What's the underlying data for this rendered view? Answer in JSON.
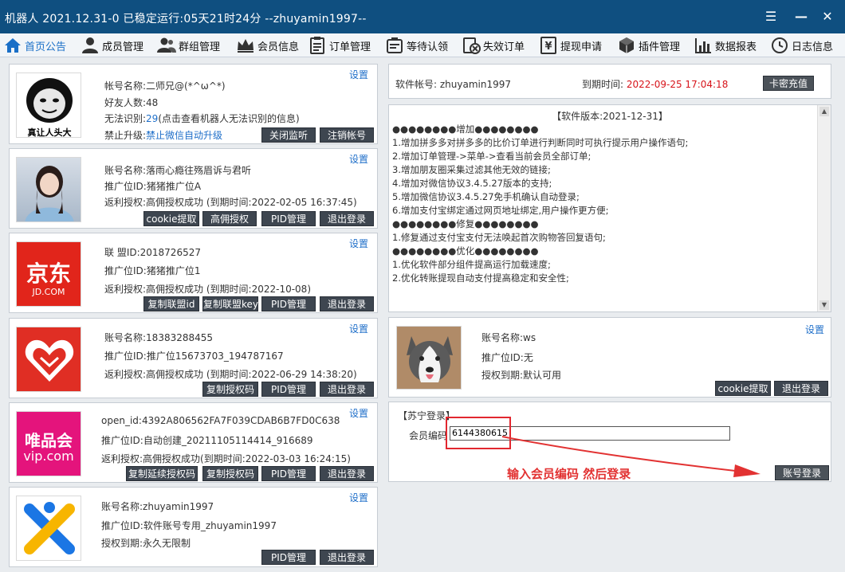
{
  "window": {
    "title": "机器人 2021.12.31-0 已稳定运行:05天21时24分 --zhuyamin1997--",
    "menu_glyph": "☰",
    "minimize_glyph": "—",
    "close_glyph": "✕"
  },
  "nav": {
    "tabs": [
      {
        "label": "首页公告",
        "icon": "home-icon"
      },
      {
        "label": "成员管理",
        "icon": "user-icon"
      },
      {
        "label": "群组管理",
        "icon": "group-icon"
      },
      {
        "label": "会员信息",
        "icon": "crown-icon"
      },
      {
        "label": "订单管理",
        "icon": "list-icon"
      },
      {
        "label": "等待认领",
        "icon": "clipboard-icon"
      },
      {
        "label": "失效订单",
        "icon": "expired-icon"
      },
      {
        "label": "提现申请",
        "icon": "withdraw-icon"
      },
      {
        "label": "插件管理",
        "icon": "cube-icon"
      },
      {
        "label": "数据报表",
        "icon": "chart-icon"
      },
      {
        "label": "日志信息",
        "icon": "log-icon"
      }
    ]
  },
  "settings_label": "设置",
  "wechat": {
    "logo_text": "真让人头大",
    "account_label": "帐号名称:",
    "account_value": "二师兄@(*^ω^*)",
    "friends_label": "好友人数:",
    "friends_value": "48",
    "unknown_label": "无法识别:",
    "unknown_value": "29",
    "unknown_note": "(点击查看机器人无法识别的信息)",
    "upgrade_label": "禁止升级:",
    "upgrade_value": "禁止微信自动升级",
    "buttons": [
      "关闭监听",
      "注销帐号"
    ]
  },
  "taobao": {
    "account": "账号名称:落雨心瘾往殇眉诉与君听",
    "promo": "推广位ID:猪猪推广位A",
    "rebate": "返利授权:高佣授权成功 (到期时间:2022-02-05 16:37:45)",
    "buttons": [
      "cookie提取",
      "高佣授权",
      "PID管理",
      "退出登录"
    ]
  },
  "jd": {
    "logo_cn": "京东",
    "logo_en": "JD.COM",
    "union": "联    盟ID:2018726527",
    "promo": "推广位ID:猪猪推广位1",
    "rebate": "返利授权:高佣授权成功 (到期时间:2022-10-08)",
    "buttons": [
      "复制联盟id",
      "复制联盟key",
      "PID管理",
      "退出登录"
    ]
  },
  "pdd": {
    "account": "账号名称:18383288455",
    "promo": "推广位ID:推广位15673703_194787167",
    "rebate": "返利授权:高佣授权成功 (到期时间:2022-06-29 14:38:20)",
    "buttons": [
      "复制授权码",
      "PID管理",
      "退出登录"
    ]
  },
  "vip": {
    "logo_cn": "唯品会",
    "logo_en": "vip.com",
    "openid": "open_id:4392A806562FA7F039CDAB6B7FD0C638",
    "promo": "推广位ID:自动创建_20211105114414_916689",
    "rebate": "返利授权:高佣授权成功(到期时间:2022-03-03 16:24:15)",
    "buttons": [
      "复制延续授权码",
      "复制授权码",
      "PID管理",
      "退出登录"
    ]
  },
  "software_plugin": {
    "account": "账号名称:zhuyamin1997",
    "promo": "推广位ID:软件账号专用_zhuyamin1997",
    "expiry": "授权到期:永久无限制",
    "buttons": [
      "PID管理",
      "退出登录"
    ]
  },
  "license": {
    "account_label": "软件帐号:",
    "account_value": "zhuyamin1997",
    "expire_label": "到期时间:",
    "expire_value": "2022-09-25 17:04:18",
    "recharge_button": "卡密充值"
  },
  "changelog": {
    "header": "【软件版本:2021-12-31】",
    "lines": [
      "●●●●●●●●增加●●●●●●●●",
      "1.增加拼多多对拼多多的比价订单进行判断同时可执行提示用户操作语句;",
      "2.增加订单管理->菜单->查看当前会员全部订单;",
      "3.增加朋友圈采集过滤其他无效的链接;",
      "4.增加对微信协议3.4.5.27版本的支持;",
      "5.增加微信协议3.4.5.27免手机确认自动登录;",
      "6.增加支付宝绑定通过网页地址绑定,用户操作更方便;",
      "●●●●●●●●修复●●●●●●●●",
      "1.修复通过支付宝支付无法唤起首次购物答回复语句;",
      "●●●●●●●●优化●●●●●●●●",
      "1.优化软件部分组件提高运行加载速度;",
      "2.优化转账提现自动支付提高稳定和安全性;"
    ]
  },
  "ws": {
    "account": "账号名称:ws",
    "promo": "推广位ID:无",
    "expiry": "授权到期:默认可用",
    "buttons": [
      "cookie提取",
      "退出登录"
    ]
  },
  "suning": {
    "section_title": "【苏宁登录】",
    "member_label": "会员编码",
    "member_value": "6144380615",
    "annotation": "输入会员编码   然后登录",
    "login_button": "账号登录"
  }
}
